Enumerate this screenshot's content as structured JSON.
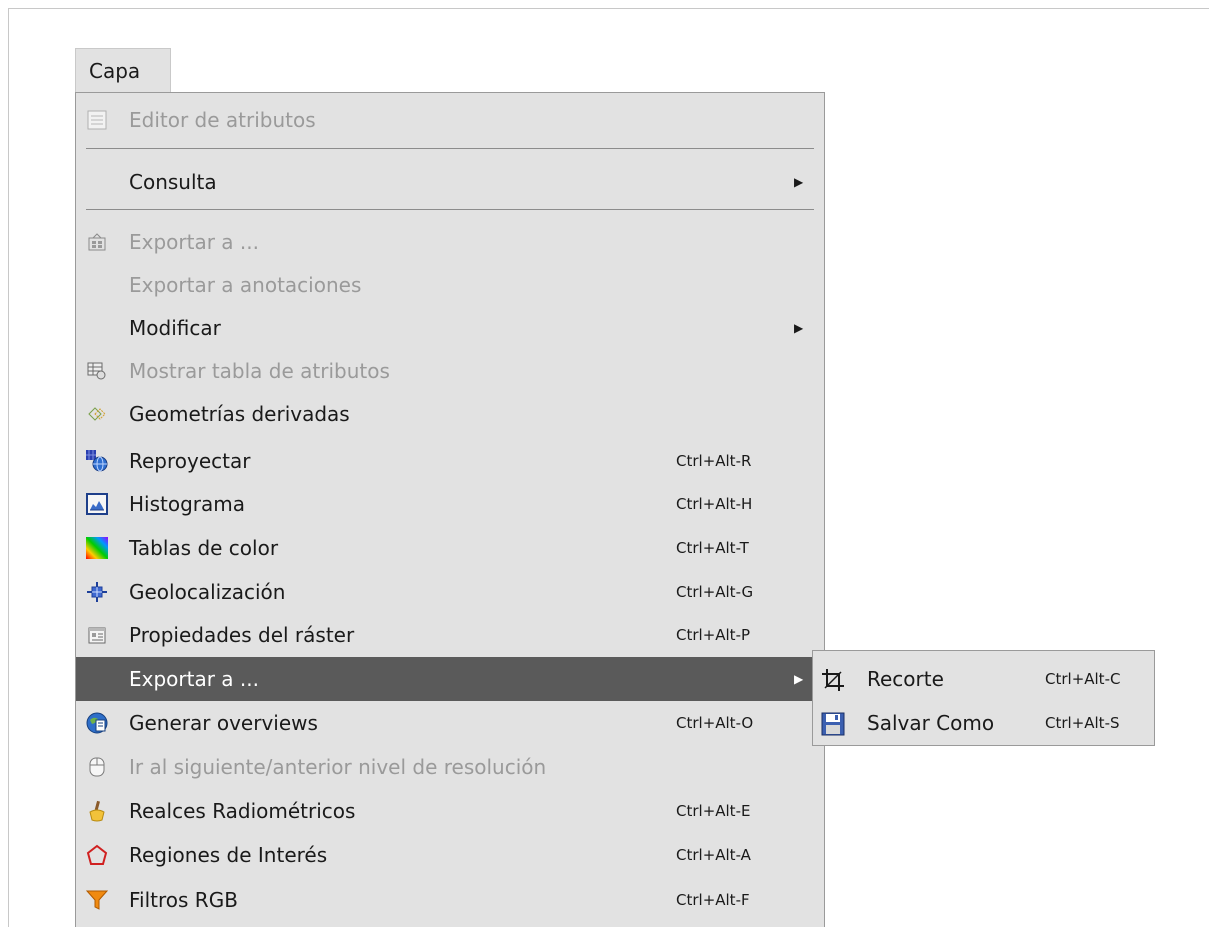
{
  "menubar": {
    "label": "Capa"
  },
  "menu": {
    "items": [
      {
        "label": "Editor de atributos",
        "shortcut": "",
        "icon": "table-icon",
        "disabled": true
      },
      {
        "label": "Consulta",
        "shortcut": "",
        "icon": "",
        "submenu": true
      },
      {
        "label": "Exportar a ...",
        "shortcut": "",
        "icon": "export-icon",
        "disabled": true
      },
      {
        "label": "Exportar a anotaciones",
        "shortcut": "",
        "icon": "",
        "disabled": true
      },
      {
        "label": "Modificar",
        "shortcut": "",
        "icon": "",
        "submenu": true
      },
      {
        "label": "Mostrar tabla de atributos",
        "shortcut": "",
        "icon": "attribute-table-icon",
        "disabled": true
      },
      {
        "label": "Geometrías derivadas",
        "shortcut": "",
        "icon": "derived-geometry-icon"
      },
      {
        "label": "Reproyectar",
        "shortcut": "Ctrl+Alt-R",
        "icon": "reproject-icon"
      },
      {
        "label": "Histograma",
        "shortcut": "Ctrl+Alt-H",
        "icon": "histogram-icon"
      },
      {
        "label": "Tablas de color",
        "shortcut": "Ctrl+Alt-T",
        "icon": "color-table-icon"
      },
      {
        "label": "Geolocalización",
        "shortcut": "Ctrl+Alt-G",
        "icon": "geolocation-icon"
      },
      {
        "label": "Propiedades del ráster",
        "shortcut": "Ctrl+Alt-P",
        "icon": "properties-icon"
      },
      {
        "label": "Exportar a ...",
        "shortcut": "",
        "icon": "",
        "submenu": true,
        "highlighted": true
      },
      {
        "label": "Generar overviews",
        "shortcut": "Ctrl+Alt-O",
        "icon": "overviews-icon"
      },
      {
        "label": "Ir al siguiente/anterior nivel de resolución",
        "shortcut": "",
        "icon": "mouse-icon",
        "disabled": true
      },
      {
        "label": "Realces Radiométricos",
        "shortcut": "Ctrl+Alt-E",
        "icon": "enhance-brush-icon"
      },
      {
        "label": "Regiones de Interés",
        "shortcut": "Ctrl+Alt-A",
        "icon": "polygon-roi-icon"
      },
      {
        "label": "Filtros RGB",
        "shortcut": "Ctrl+Alt-F",
        "icon": "filter-funnel-icon"
      }
    ]
  },
  "submenu": {
    "items": [
      {
        "label": "Recorte",
        "shortcut": "Ctrl+Alt-C",
        "icon": "crop-icon"
      },
      {
        "label": "Salvar Como",
        "shortcut": "Ctrl+Alt-S",
        "icon": "save-as-icon"
      }
    ]
  },
  "colors": {
    "menu_bg": "#e2e2e2",
    "highlight_bg": "#5a5a5a",
    "disabled_text": "#9a9a9a"
  }
}
